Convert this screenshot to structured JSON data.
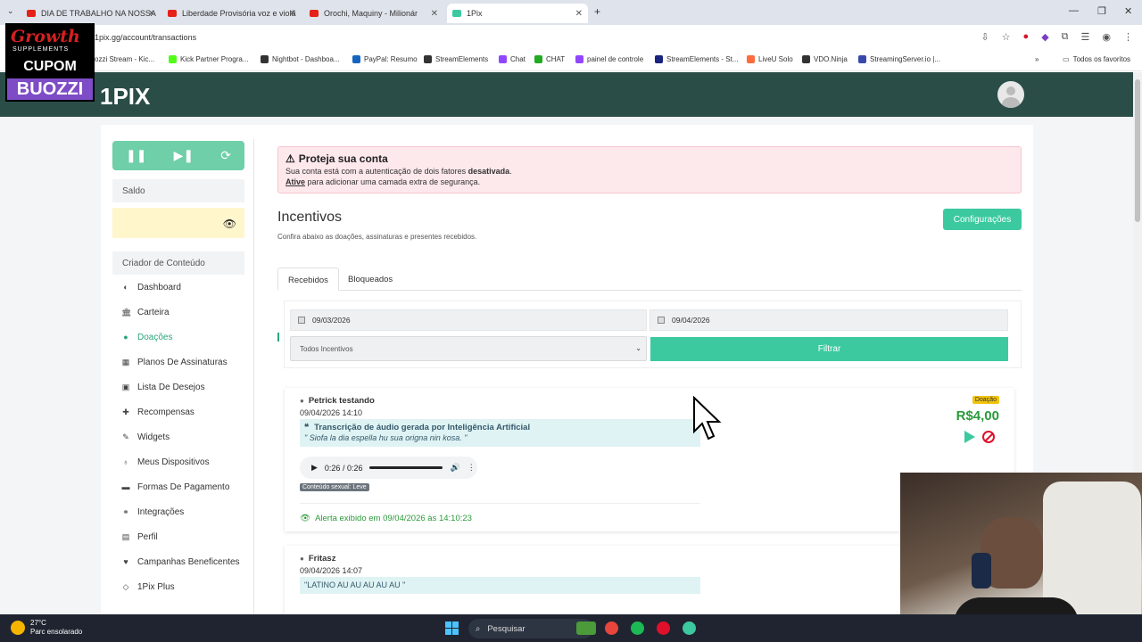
{
  "browser": {
    "tabs": [
      {
        "title": "DIA DE TRABALHO NA NOSSA"
      },
      {
        "title": "Liberdade Provisória voz e violã"
      },
      {
        "title": "Orochi, Maquiny - Milionár"
      },
      {
        "title": "1Pix"
      }
    ],
    "url": "1pix.gg/account/transactions",
    "bookmarks": [
      {
        "label": "ozzi Stream - Kic..."
      },
      {
        "label": "Kick Partner Progra..."
      },
      {
        "label": "Nightbot - Dashboa..."
      },
      {
        "label": "PayPal: Resumo"
      },
      {
        "label": "StreamElements"
      },
      {
        "label": "Chat"
      },
      {
        "label": "CHAT"
      },
      {
        "label": "painel de controle"
      },
      {
        "label": "StreamElements - St..."
      },
      {
        "label": "LiveU Solo"
      },
      {
        "label": "VDO.Ninja"
      },
      {
        "label": "StreamingServer.io |..."
      }
    ],
    "bookmarks_folder": "Todos os favoritos"
  },
  "promo": {
    "brand": "Growth",
    "brand_sub": "SUPPLEMENTS",
    "cupom": "CUPOM",
    "code": "BUOZZI"
  },
  "app": {
    "logo": "1PIX"
  },
  "sidebar": {
    "saldo_label": "Saldo",
    "section_label": "Criador de Conteúdo",
    "items": [
      {
        "label": "Dashboard",
        "icon": "dashboard-icon"
      },
      {
        "label": "Carteira",
        "icon": "bank-icon"
      },
      {
        "label": "Doações",
        "icon": "chat-icon"
      },
      {
        "label": "Planos De Assinaturas",
        "icon": "table-icon"
      },
      {
        "label": "Lista De Desejos",
        "icon": "gift-icon"
      },
      {
        "label": "Recompensas",
        "icon": "puzzle-icon"
      },
      {
        "label": "Widgets",
        "icon": "edit-icon"
      },
      {
        "label": "Meus Dispositivos",
        "icon": "bulb-icon"
      },
      {
        "label": "Formas De Pagamento",
        "icon": "card-icon"
      },
      {
        "label": "Integrações",
        "icon": "link-icon"
      },
      {
        "label": "Perfil",
        "icon": "profile-icon"
      },
      {
        "label": "Campanhas Beneficentes",
        "icon": "heart-icon"
      },
      {
        "label": "1Pix Plus",
        "icon": "diamond-icon"
      }
    ]
  },
  "alert": {
    "title": "Proteja sua conta",
    "line1_pre": "Sua conta está com a autenticação de dois fatores",
    "line1_bold": "desativada",
    "line1_post": ".",
    "line2_link": "Ative",
    "line2_post": "para adicionar uma camada extra de segurança."
  },
  "main": {
    "title": "Incentivos",
    "subtitle": "Confira abaixo as doações, assinaturas e presentes recebidos.",
    "config_button": "Configurações",
    "tabs": [
      {
        "label": "Recebidos"
      },
      {
        "label": "Bloqueados"
      }
    ],
    "date_from": "09/03/2026",
    "date_to": "09/04/2026",
    "select_value": "Todos Incentivos",
    "filter_button": "Filtrar"
  },
  "donations": [
    {
      "donor": "Petrick testando",
      "datetime": "09/04/2026 14:10",
      "message_title": "Transcrição de áudio gerada por Inteligência Artificial",
      "message_text": "\" Siofa la dia espella hu sua origna nin kosa. \"",
      "audio_time": "0:26 / 0:26",
      "content_badge": "Conteúdo sexual: Leve",
      "alert_shown": "Alerta exibido em 09/04/2026 às 14:10:23",
      "type_badge": "Doação",
      "amount": "R$4,00"
    },
    {
      "donor": "Fritasz",
      "datetime": "09/04/2026 14:07",
      "message_text": "\"LATINO AU AU AU AU AU \""
    }
  ],
  "taskbar": {
    "temp": "27°C",
    "weather": "Parc ensolarado",
    "search": "Pesquisar"
  },
  "colors": {
    "accent": "#3cc9a0",
    "appbar": "#2b4d48",
    "amount": "#2a9a3a"
  }
}
